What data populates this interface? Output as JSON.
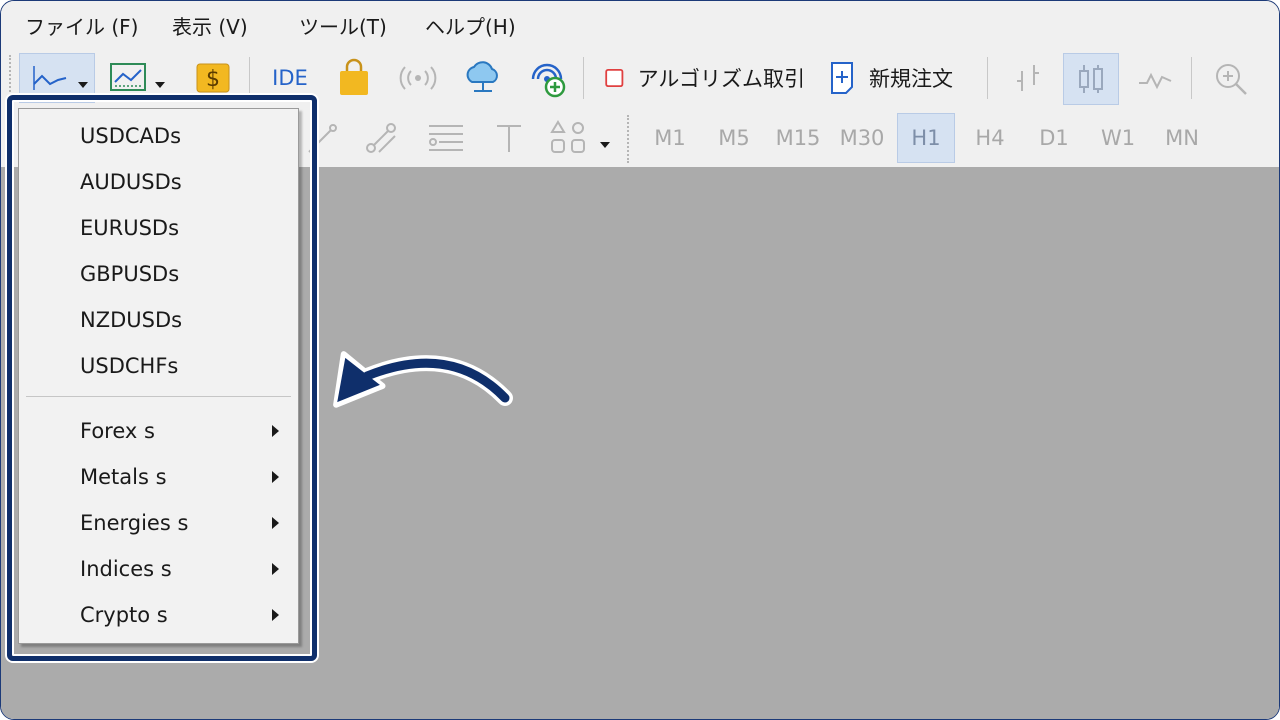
{
  "menubar": {
    "items": [
      {
        "label": "ファイル (F)"
      },
      {
        "label": "表示 (V)"
      },
      {
        "label": "ツール(T)"
      },
      {
        "label": "ヘルプ(H)"
      }
    ]
  },
  "toolbar": {
    "ide_label": "IDE",
    "algo_trading_label": "アルゴリズム取引",
    "new_order_label": "新規注文"
  },
  "timeframes": [
    "M1",
    "M5",
    "M15",
    "M30",
    "H1",
    "H4",
    "D1",
    "W1",
    "MN"
  ],
  "active_timeframe": "H1",
  "symbol_menu": {
    "symbols": [
      "USDCADs",
      "AUDUSDs",
      "EURUSDs",
      "GBPUSDs",
      "NZDUSDs",
      "USDCHFs"
    ],
    "groups": [
      "Forex s",
      "Metals s",
      "Energies s",
      "Indices s",
      "Crypto s"
    ]
  },
  "colors": {
    "highlight_border": "#0f2f6b",
    "chart_background": "#ababab",
    "accent_blue": "#2563c9",
    "algo_icon_red": "#e04040",
    "dollar_icon_gold": "#f2b821"
  }
}
